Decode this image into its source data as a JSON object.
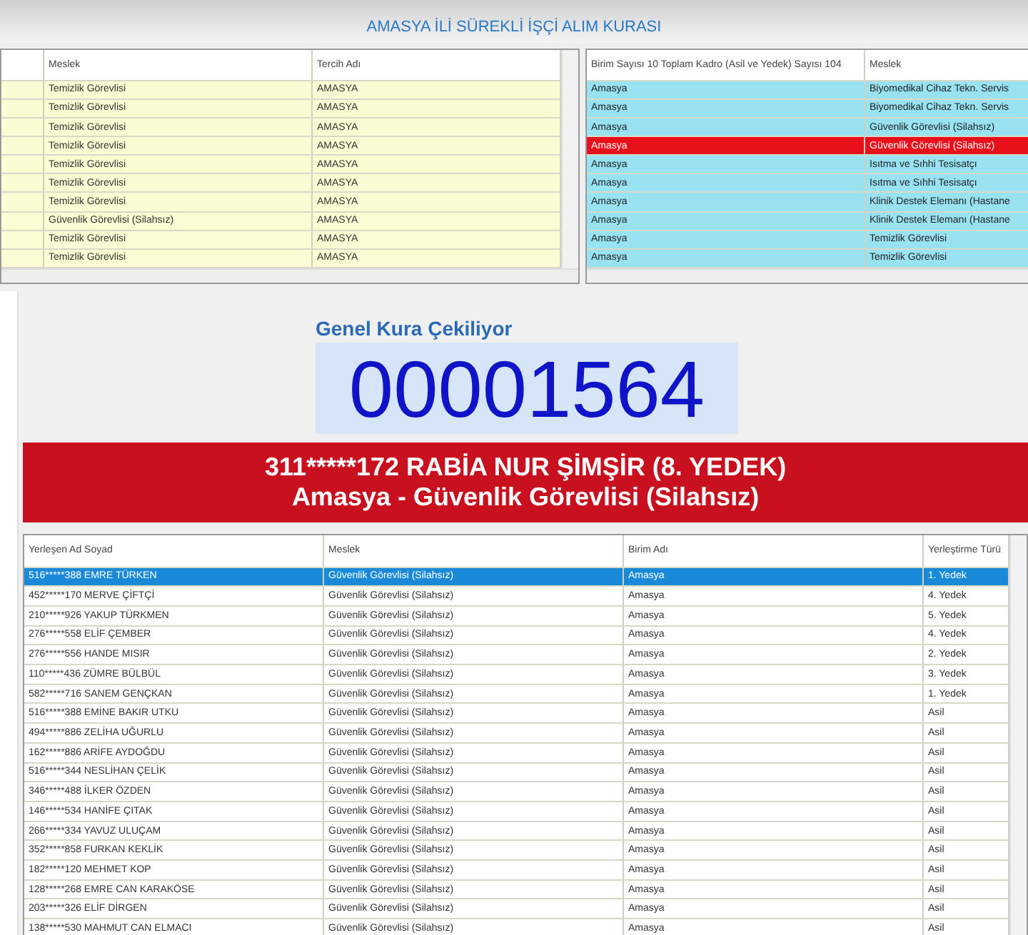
{
  "window": {
    "title": "AMASYA İLİ SÜREKLİ İŞÇİ ALIM KURASI"
  },
  "preferences_table": {
    "columns": [
      "Meslek",
      "Tercih Adı"
    ],
    "rows": [
      {
        "cells": [
          "Temizlik Görevlisi",
          "AMASYA"
        ]
      },
      {
        "cells": [
          "Temizlik Görevlisi",
          "AMASYA"
        ]
      },
      {
        "cells": [
          "Temizlik Görevlisi",
          "AMASYA"
        ]
      },
      {
        "cells": [
          "Temizlik Görevlisi",
          "AMASYA"
        ]
      },
      {
        "cells": [
          "Temizlik Görevlisi",
          "AMASYA"
        ]
      },
      {
        "cells": [
          "Temizlik Görevlisi",
          "AMASYA"
        ]
      },
      {
        "cells": [
          "Temizlik Görevlisi",
          "AMASYA"
        ]
      },
      {
        "cells": [
          "Güvenlik Görevlisi (Silahsız)",
          "AMASYA"
        ]
      },
      {
        "cells": [
          "Temizlik Görevlisi",
          "AMASYA"
        ]
      },
      {
        "cells": [
          "Temizlik Görevlisi",
          "AMASYA"
        ]
      }
    ]
  },
  "units_table": {
    "columns": [
      "Birim Sayısı 10 Toplam Kadro (Asil ve Yedek) Sayısı 104",
      "Meslek"
    ],
    "rows": [
      {
        "cells": [
          "Amasya",
          "Biyomedikal Cihaz Tekn. Servis"
        ],
        "selected": false
      },
      {
        "cells": [
          "Amasya",
          "Biyomedikal Cihaz Tekn. Servis"
        ],
        "selected": false
      },
      {
        "cells": [
          "Amasya",
          "Güvenlik Görevlisi (Silahsız)"
        ],
        "selected": false
      },
      {
        "cells": [
          "Amasya",
          "Güvenlik Görevlisi (Silahsız)"
        ],
        "selected": true
      },
      {
        "cells": [
          "Amasya",
          "Isıtma ve Sıhhi Tesisatçı"
        ],
        "selected": false
      },
      {
        "cells": [
          "Amasya",
          "Isıtma ve Sıhhi Tesisatçı"
        ],
        "selected": false
      },
      {
        "cells": [
          "Amasya",
          "Klinik Destek Elemanı (Hastane"
        ],
        "selected": false
      },
      {
        "cells": [
          "Amasya",
          "Klinik Destek Elemanı (Hastane"
        ],
        "selected": false
      },
      {
        "cells": [
          "Amasya",
          "Temizlik Görevlisi"
        ],
        "selected": false
      },
      {
        "cells": [
          "Amasya",
          "Temizlik Görevlisi"
        ],
        "selected": false
      }
    ]
  },
  "draw": {
    "heading": "Genel Kura Çekiliyor",
    "number": "00001564",
    "winner": "311*****172 RABİA NUR ŞİMŞİR (8. YEDEK)",
    "position": "Amasya - Güvenlik Görevlisi (Silahsız)"
  },
  "placements_table": {
    "columns": [
      "Yerleşen Ad Soyad",
      "Meslek",
      "Birim Adı",
      "Yerleştirme Türü"
    ],
    "rows": [
      {
        "cells": [
          "516*****388 EMRE TÜRKEN",
          "Güvenlik Görevlisi (Silahsız)",
          "Amasya",
          "1. Yedek"
        ],
        "selected": true
      },
      {
        "cells": [
          "452*****170 MERVE ÇİFTÇİ",
          "Güvenlik Görevlisi (Silahsız)",
          "Amasya",
          "4. Yedek"
        ],
        "selected": false
      },
      {
        "cells": [
          "210*****926 YAKUP TÜRKMEN",
          "Güvenlik Görevlisi (Silahsız)",
          "Amasya",
          "5. Yedek"
        ],
        "selected": false
      },
      {
        "cells": [
          "276*****558 ELİF ÇEMBER",
          "Güvenlik Görevlisi (Silahsız)",
          "Amasya",
          "4. Yedek"
        ],
        "selected": false
      },
      {
        "cells": [
          "276*****556 HANDE MISIR",
          "Güvenlik Görevlisi (Silahsız)",
          "Amasya",
          "2. Yedek"
        ],
        "selected": false
      },
      {
        "cells": [
          "110*****436 ZÜMRE BÜLBÜL",
          "Güvenlik Görevlisi (Silahsız)",
          "Amasya",
          "3. Yedek"
        ],
        "selected": false
      },
      {
        "cells": [
          "582*****716 SANEM GENÇKAN",
          "Güvenlik Görevlisi (Silahsız)",
          "Amasya",
          "1. Yedek"
        ],
        "selected": false
      },
      {
        "cells": [
          "516*****388 EMİNE BAKIR UTKU",
          "Güvenlik Görevlisi (Silahsız)",
          "Amasya",
          "Asil"
        ],
        "selected": false
      },
      {
        "cells": [
          "494*****886 ZELİHA UĞURLU",
          "Güvenlik Görevlisi (Silahsız)",
          "Amasya",
          "Asil"
        ],
        "selected": false
      },
      {
        "cells": [
          "162*****886 ARİFE AYDOĞDU",
          "Güvenlik Görevlisi (Silahsız)",
          "Amasya",
          "Asil"
        ],
        "selected": false
      },
      {
        "cells": [
          "516*****344 NESLİHAN ÇELİK",
          "Güvenlik Görevlisi (Silahsız)",
          "Amasya",
          "Asil"
        ],
        "selected": false
      },
      {
        "cells": [
          "346*****488 İLKER ÖZDEN",
          "Güvenlik Görevlisi (Silahsız)",
          "Amasya",
          "Asil"
        ],
        "selected": false
      },
      {
        "cells": [
          "146*****534 HANİFE ÇITAK",
          "Güvenlik Görevlisi (Silahsız)",
          "Amasya",
          "Asil"
        ],
        "selected": false
      },
      {
        "cells": [
          "266*****334 YAVUZ ULUÇAM",
          "Güvenlik Görevlisi (Silahsız)",
          "Amasya",
          "Asil"
        ],
        "selected": false
      },
      {
        "cells": [
          "352*****858 FURKAN KEKLİK",
          "Güvenlik Görevlisi (Silahsız)",
          "Amasya",
          "Asil"
        ],
        "selected": false
      },
      {
        "cells": [
          "182*****120 MEHMET KOP",
          "Güvenlik Görevlisi (Silahsız)",
          "Amasya",
          "Asil"
        ],
        "selected": false
      },
      {
        "cells": [
          "128*****268 EMRE CAN KARAKÖSE",
          "Güvenlik Görevlisi (Silahsız)",
          "Amasya",
          "Asil"
        ],
        "selected": false
      },
      {
        "cells": [
          "203*****326 ELİF DİRGEN",
          "Güvenlik Görevlisi (Silahsız)",
          "Amasya",
          "Asil"
        ],
        "selected": false
      },
      {
        "cells": [
          "138*****530 MAHMUT CAN ELMACI",
          "Güvenlik Görevlisi (Silahsız)",
          "Amasya",
          "Asil"
        ],
        "selected": false
      }
    ]
  }
}
